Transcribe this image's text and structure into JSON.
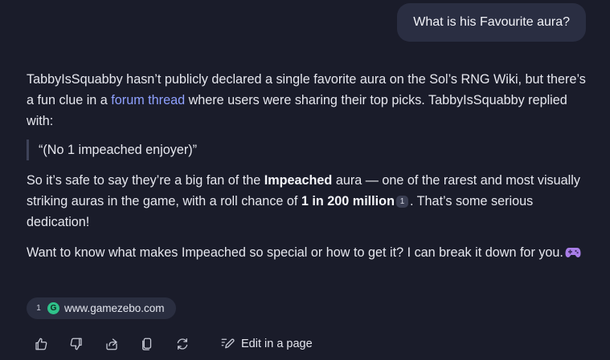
{
  "user_message": "What is his Favourite aura?",
  "answer": {
    "p1": {
      "before_link": "TabbyIsSquabby hasn’t publicly declared a single favorite aura on the Sol’s RNG Wiki, but there’s a fun clue in a ",
      "link_text": "forum thread",
      "after_link": " where users were sharing their top picks. TabbyIsSquabby replied with:"
    },
    "quote": "“(No 1 impeached enjoyer)”",
    "p2": {
      "part1": "So it’s safe to say they’re a big fan of the ",
      "bold1": "Impeached",
      "part2": " aura — one of the rarest and most visually striking auras in the game, with a roll chance of ",
      "bold2": "1 in 200 million",
      "citation": "1",
      "part3": ". That’s some serious dedication!"
    },
    "p3": {
      "text": "Want to know what makes Impeached so special or how to get it? I can break it down for you.",
      "emoji_icon": "gamepad-icon"
    }
  },
  "source": {
    "number": "1",
    "favicon_letter": "G",
    "favicon_color": "#2fc28a",
    "domain": "www.gamezebo.com"
  },
  "toolbar": {
    "icons": [
      "thumbs-up-icon",
      "thumbs-down-icon",
      "share-icon",
      "copy-icon",
      "regenerate-icon",
      "edit-page-icon"
    ],
    "edit_label": "Edit in a page"
  },
  "colors": {
    "background": "#1a1c2a",
    "user_bubble": "#2a2e42",
    "link": "#8fa1ff",
    "emoji_purple": "#a97ee8"
  }
}
